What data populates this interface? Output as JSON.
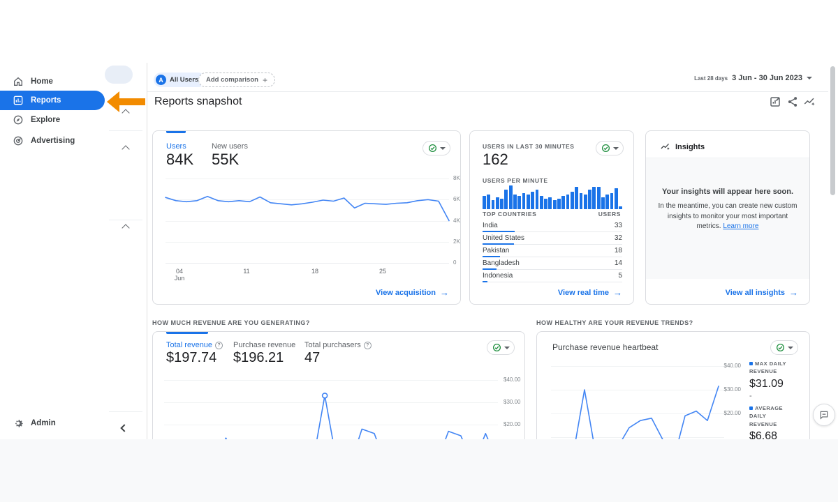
{
  "icons": {
    "arrow_right": "→",
    "plus": "+"
  },
  "colors": {
    "accent": "#1a73e8",
    "chart_line": "#4285f4",
    "ok_green": "#1e8e3e",
    "annotation_orange": "#f28b00"
  },
  "sidebar": {
    "items": [
      {
        "label": "Home",
        "active": false
      },
      {
        "label": "Reports",
        "active": true
      },
      {
        "label": "Explore",
        "active": false
      },
      {
        "label": "Advertising",
        "active": false
      }
    ],
    "admin": "Admin"
  },
  "topbar": {
    "avatar_letter": "A",
    "all_users": "All Users",
    "add_comparison": "Add comparison",
    "date_preset": "Last 28 days",
    "date_range": "3 Jun - 30 Jun 2023"
  },
  "page": {
    "title": "Reports snapshot"
  },
  "cards": {
    "users": {
      "metric1_label": "Users",
      "metric1_value": "84K",
      "metric2_label": "New users",
      "metric2_value": "55K",
      "y_ticks": [
        "8K",
        "6K",
        "4K",
        "2K",
        "0"
      ],
      "x_tick1a": "04",
      "x_tick1b": "Jun",
      "x_ticks": [
        "11",
        "18",
        "25"
      ],
      "footer": "View acquisition"
    },
    "realtime": {
      "title": "USERS IN LAST 30 MINUTES",
      "value": "162",
      "per_minute_label": "USERS PER MINUTE",
      "countries_header": "TOP COUNTRIES",
      "users_header": "USERS",
      "countries": [
        {
          "name": "India",
          "users": 33
        },
        {
          "name": "United States",
          "users": 32
        },
        {
          "name": "Pakistan",
          "users": 18
        },
        {
          "name": "Bangladesh",
          "users": 14
        },
        {
          "name": "Indonesia",
          "users": 5
        }
      ],
      "footer": "View real time"
    },
    "insights": {
      "header": "Insights",
      "headline": "Your insights will appear here soon.",
      "body": "In the meantime, you can create new custom insights to monitor your most important metrics. ",
      "link": "Learn more",
      "footer": "View all insights"
    },
    "revenue": {
      "section_label": "HOW MUCH REVENUE ARE YOU GENERATING?",
      "metric1_label": "Total revenue",
      "metric1_value": "$197.74",
      "metric2_label": "Purchase revenue",
      "metric2_value": "$196.21",
      "metric3_label": "Total purchasers",
      "metric3_value": "47",
      "y_ticks": [
        "$40.00",
        "$30.00",
        "$20.00"
      ]
    },
    "heartbeat": {
      "section_label": "HOW HEALTHY ARE YOUR REVENUE TRENDS?",
      "title": "Purchase revenue heartbeat",
      "y_ticks": [
        "$40.00",
        "$30.00",
        "$20.00"
      ],
      "legend": {
        "max_label": "MAX DAILY REVENUE",
        "max_value": "$31.09",
        "max_sub": "-",
        "avg_label": "AVERAGE DAILY REVENUE",
        "avg_value": "$6.68"
      }
    }
  },
  "chart_data": [
    {
      "id": "users_trend",
      "type": "line",
      "title": "Users by day (3 Jun - 30 Jun 2023)",
      "x_ticks": [
        "04 Jun",
        "11",
        "18",
        "25"
      ],
      "values": [
        6200,
        5900,
        5800,
        5900,
        6300,
        5900,
        5800,
        5900,
        5800,
        6250,
        5700,
        5600,
        5500,
        5600,
        5750,
        5950,
        5850,
        6150,
        5200,
        5650,
        5600,
        5550,
        5650,
        5700,
        5900,
        6000,
        5850,
        4000
      ],
      "ylim": [
        0,
        8000
      ],
      "y_ticks": [
        "8K",
        "6K",
        "4K",
        "2K",
        "0"
      ]
    },
    {
      "id": "users_per_minute",
      "type": "bar",
      "title": "Users per minute (last 30 minutes)",
      "values": [
        9,
        10,
        6,
        8,
        7,
        13,
        16,
        10,
        9,
        11,
        10,
        12,
        13,
        9,
        7,
        8,
        6,
        7,
        9,
        10,
        12,
        15,
        11,
        10,
        13,
        15,
        15,
        8,
        10,
        11,
        14,
        2
      ],
      "ylim": [
        0,
        16
      ]
    },
    {
      "id": "purchase_revenue_trend",
      "type": "line",
      "title": "Total revenue by day",
      "values": [
        2,
        1,
        2,
        3,
        2,
        14,
        2,
        1,
        3,
        2,
        2,
        3,
        2,
        33,
        2,
        1,
        18,
        16,
        1,
        2,
        3,
        2,
        2,
        17,
        15,
        2,
        16,
        3
      ],
      "ylim": [
        0,
        40
      ],
      "y_ticks": [
        "$40.00",
        "$30.00",
        "$20.00"
      ],
      "marker_index": 13
    },
    {
      "id": "purchase_revenue_heartbeat",
      "type": "line",
      "title": "Purchase revenue heartbeat",
      "values": [
        2,
        0.5,
        3,
        30,
        3,
        0.5,
        6,
        14,
        17,
        18,
        9,
        1,
        19,
        21,
        17,
        31.5
      ],
      "ylim": [
        0,
        40
      ],
      "y_ticks": [
        "$40.00",
        "$30.00",
        "$20.00"
      ]
    }
  ]
}
